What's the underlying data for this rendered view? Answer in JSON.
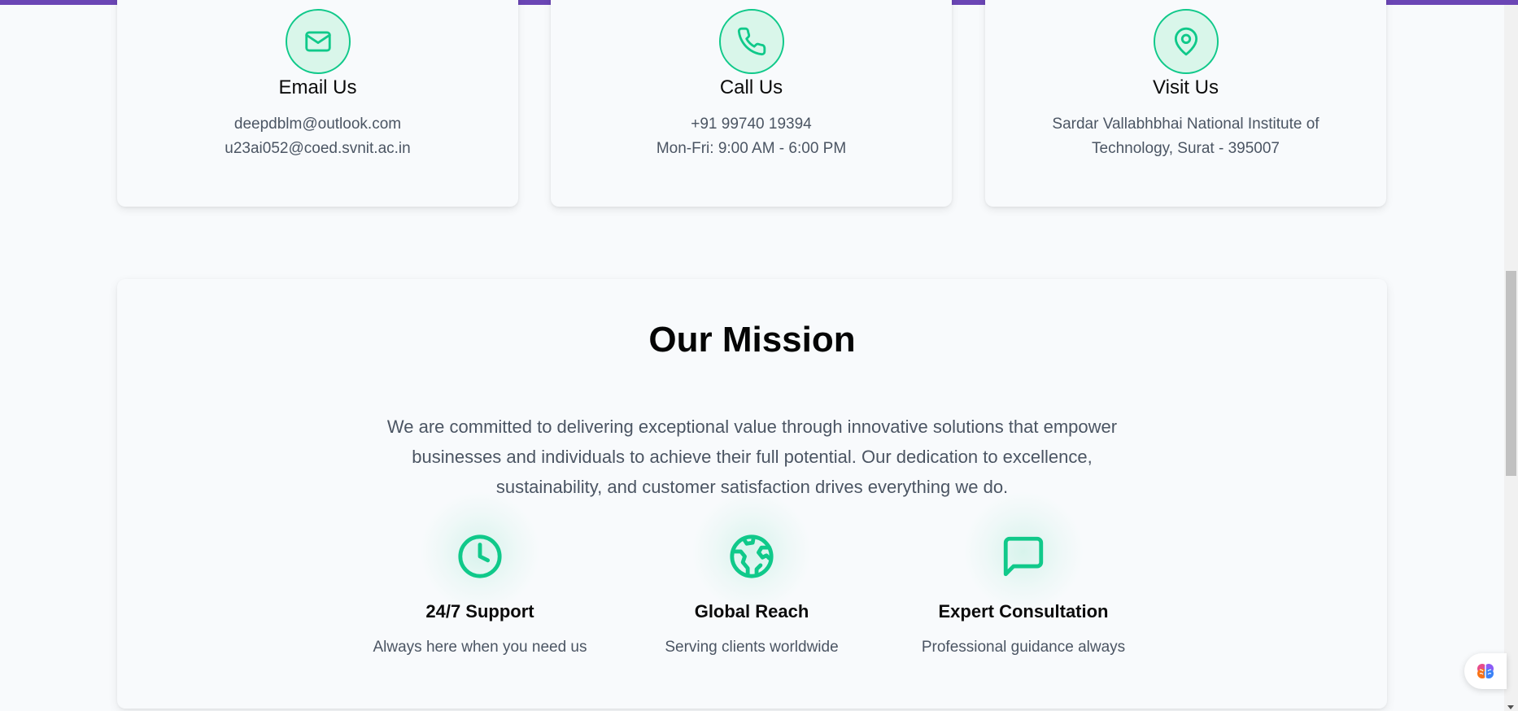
{
  "colors": {
    "accent": "#10c98a",
    "top_bar": "#6b46b5",
    "text_muted": "#4b5563"
  },
  "contact": [
    {
      "icon": "mail-icon",
      "title": "Email Us",
      "lines": [
        "deepdblm@outlook.com",
        "u23ai052@coed.svnit.ac.in"
      ]
    },
    {
      "icon": "phone-icon",
      "title": "Call Us",
      "lines": [
        "+91 99740 19394",
        "Mon-Fri: 9:00 AM - 6:00 PM"
      ]
    },
    {
      "icon": "map-pin-icon",
      "title": "Visit Us",
      "lines": [
        "Sardar Vallabhbhai National Institute of Technology, Surat - 395007"
      ]
    }
  ],
  "mission": {
    "title": "Our Mission",
    "text": "We are committed to delivering exceptional value through innovative solutions that empower businesses and individuals to achieve their full potential. Our dedication to excellence, sustainability, and customer satisfaction drives everything we do.",
    "features": [
      {
        "icon": "clock-icon",
        "title": "24/7 Support",
        "subtitle": "Always here when you need us"
      },
      {
        "icon": "globe-icon",
        "title": "Global Reach",
        "subtitle": "Serving clients worldwide"
      },
      {
        "icon": "chat-bubble-icon",
        "title": "Expert Consultation",
        "subtitle": "Professional guidance always"
      }
    ]
  },
  "assistant": {
    "icon": "brain-icon"
  }
}
